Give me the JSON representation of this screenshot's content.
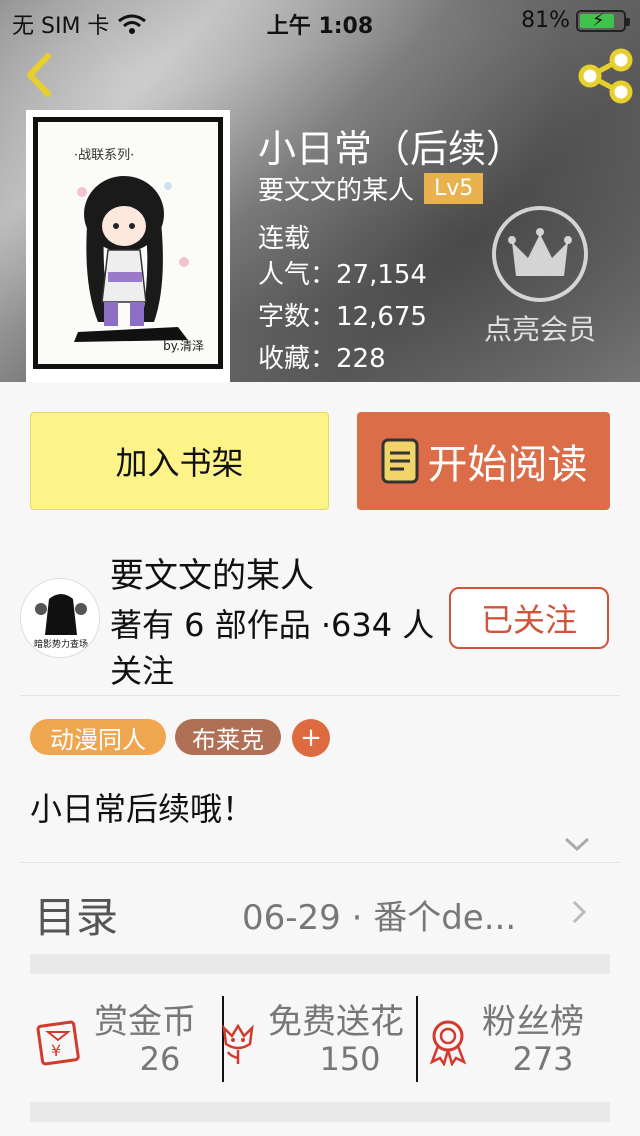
{
  "status_bar": {
    "carrier": "无 SIM 卡",
    "time": "上午 1:08",
    "battery": "81%",
    "battery_level": 0.81
  },
  "book": {
    "title": "小日常（后续）",
    "author": "要文文的某人",
    "level": "Lv5",
    "status": "连载",
    "popularity": "人气：27,154",
    "word_count": "字数：12,675",
    "favorites": "收藏：228",
    "vip_label": "点亮会员",
    "cover_caption": "·战联系列·",
    "cover_sign": "by.清泽"
  },
  "actions": {
    "add_shelf": "加入书架",
    "start_read": "开始阅读"
  },
  "author_card": {
    "name": "要文文的某人",
    "meta": "著有 6 部作品 ·634 人关注",
    "follow": "已关注",
    "avatar_text": "暗影势力查场"
  },
  "tags": [
    "动漫同人",
    "布莱克"
  ],
  "tag_add": "+",
  "description": "小日常后续哦！",
  "catalog": {
    "label": "目录",
    "latest": "06-29 · 番个de..."
  },
  "rewards": [
    {
      "label": "赏金币",
      "value": "26"
    },
    {
      "label": "免费送花",
      "value": "150"
    },
    {
      "label": "粉丝榜",
      "value": "273"
    }
  ],
  "colors": {
    "accent": "#dc6d49",
    "shelf": "#fdf389",
    "level": "#e9b24f",
    "follow": "#d1543a"
  }
}
